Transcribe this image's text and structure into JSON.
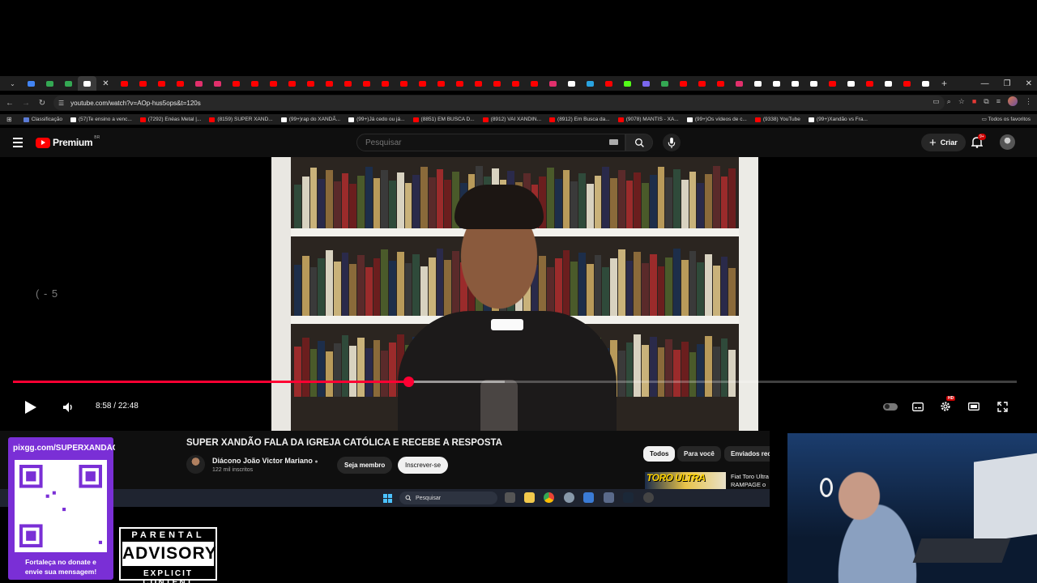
{
  "browser": {
    "url": "youtube.com/watch?v=AOp-hus5ops&t=120s",
    "bookmarks": [
      {
        "label": "Classificação",
        "color": "#5b7bd6"
      },
      {
        "label": "(57)Te ensino a venc...",
        "color": "#ffffff"
      },
      {
        "label": "(7292) Enéas Metal |...",
        "color": "#ff0000"
      },
      {
        "label": "(8159) SUPER XAND...",
        "color": "#ff0000"
      },
      {
        "label": "(99+)rap do XANDÃ...",
        "color": "#ffffff"
      },
      {
        "label": "(99+)Já cedo ou já...",
        "color": "#ffffff"
      },
      {
        "label": "(8851) EM BUSCA D...",
        "color": "#ff0000"
      },
      {
        "label": "(8912) VAI XANDIN...",
        "color": "#ff0000"
      },
      {
        "label": "(8912) Em Busca da...",
        "color": "#ff0000"
      },
      {
        "label": "(9078) MANTIS - XA...",
        "color": "#ff0000"
      },
      {
        "label": "(99+)Os vídeos de c...",
        "color": "#ffffff"
      },
      {
        "label": "(9338) YouTube",
        "color": "#ff0000"
      },
      {
        "label": "(99+)Xandão vs Fra...",
        "color": "#ffffff"
      }
    ],
    "all_bookmarks_label": "Todos os favoritos",
    "tab_colors": [
      "#4285f4",
      "#34a853",
      "#34a853",
      "#ffffff",
      "#ff0000",
      "#ff0000",
      "#ff0000",
      "#ff0000",
      "#e1306c",
      "#e1306c",
      "#ff0000",
      "#ff0000",
      "#ff0000",
      "#ff0000",
      "#ff0000",
      "#ff0000",
      "#ff0000",
      "#ff0000",
      "#ff0000",
      "#ff0000",
      "#ff0000",
      "#ff0000",
      "#ff0000",
      "#ff0000",
      "#ff0000",
      "#ff0000",
      "#ff0000",
      "#e1306c",
      "#ffffff",
      "#2aa3e0",
      "#ff0000",
      "#53fc18",
      "#7b68ee",
      "#34a853",
      "#ff0000",
      "#ff0000",
      "#ff0000",
      "#e1306c",
      "#ffffff",
      "#ffffff",
      "#ffffff",
      "#ffffff",
      "#ff0000",
      "#ffffff",
      "#ff0000",
      "#ffffff",
      "#ff0000",
      "#ffffff"
    ]
  },
  "youtube": {
    "logo_text": "Premium",
    "country_code": "BR",
    "search_placeholder": "Pesquisar",
    "create_label": "Criar",
    "notification_count": "9+"
  },
  "player": {
    "skip_hint": "( - 5",
    "current_time": "8:58",
    "separator": " / ",
    "duration": "22:48",
    "played_fraction": 0.394,
    "loaded_fraction": 0.49,
    "accent": "#ff0033"
  },
  "video": {
    "title": "SUPER XANDÃO FALA DA IGREJA CATÓLICA E RECEBE A RESPOSTA",
    "channel_name": "Diácono João Victor Mariano",
    "subscribers": "122 mil inscritos",
    "member_label": "Seja membro",
    "subscribe_label": "Inscrever-se"
  },
  "recommendations": {
    "chips": [
      "Todos",
      "Para você",
      "Enviados rec"
    ],
    "first_thumb_text": "TORO ULTRA",
    "first_title": "Fiat Toro Ultra RAMPAGE o"
  },
  "taskbar": {
    "search_label": "Pesquisar"
  },
  "overlay": {
    "donate_url": "pixgg.com/SUPERXANDÃO",
    "donate_message_line1": "Fortaleça no donate e",
    "donate_message_line2": "envie sua mensagem!",
    "advisory_top": "PARENTAL",
    "advisory_mid": "ADVISORY",
    "advisory_bottom": "EXPLICIT CONTENT"
  }
}
